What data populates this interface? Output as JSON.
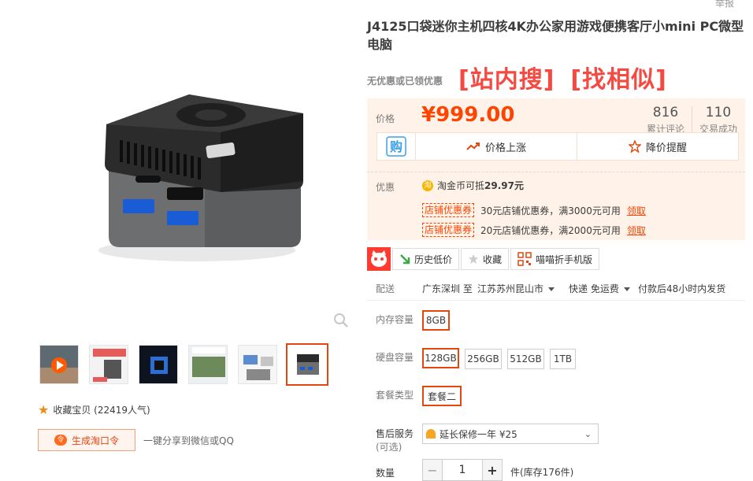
{
  "header": {
    "report_label": "举报"
  },
  "product": {
    "title": "J4125口袋迷你主机四核4K办公家用游戏便携客厅小mini PC微型电脑",
    "promo_note": "无优惠或已领优惠",
    "link_search": "[站内搜]",
    "link_similar": "[找相似]"
  },
  "price": {
    "label": "价格",
    "value": "¥999.00",
    "review_count": "816",
    "review_label": "累计评论",
    "sold_count": "110",
    "sold_label": "交易成功"
  },
  "actions": {
    "buy_icon_text": "购",
    "price_up": "价格上涨",
    "price_drop_alert": "降价提醒"
  },
  "coupons": {
    "label": "优惠",
    "coin_text": "淘金币可抵",
    "coin_amount": "29.97元",
    "coin_icon": "淘",
    "items": [
      {
        "tag": "店铺优惠券",
        "desc": "30元店铺优惠券，满3000元可用",
        "action": "领取"
      },
      {
        "tag": "店铺优惠券",
        "desc": "20元店铺优惠券，满2000元可用",
        "action": "领取"
      }
    ]
  },
  "tools": {
    "history_price": "历史低价",
    "favorite": "收藏",
    "mobile_version": "喵喵折手机版"
  },
  "shipping": {
    "label": "配送",
    "from": "广东深圳 至",
    "to": "江苏苏州昆山市",
    "method": "快递 免运费",
    "note": "付款后48小时内发货"
  },
  "options": {
    "memory_label": "内存容量",
    "memory": [
      "8GB"
    ],
    "disk_label": "硬盘容量",
    "disk": [
      "128GB",
      "256GB",
      "512GB",
      "1TB"
    ],
    "package_label": "套餐类型",
    "package": [
      "套餐二"
    ],
    "service_label": "售后服务",
    "service_sub": "(可选)",
    "service_value": "延长保修一年 ¥25"
  },
  "quantity": {
    "label": "数量",
    "value": "1",
    "minus": "−",
    "plus": "+",
    "stock": "件(库存176件)"
  },
  "gallery": {
    "favorite_text": "收藏宝贝 (22419人气)",
    "generate_button": "生成淘口令",
    "share_text": "一键分享到微信或QQ",
    "thumbs": [
      "video",
      "p2",
      "p3",
      "p4",
      "p5",
      "p6"
    ]
  },
  "colors": {
    "accent": "#f40",
    "link_red": "#f54a41",
    "price_bg": "#fff2e8"
  }
}
